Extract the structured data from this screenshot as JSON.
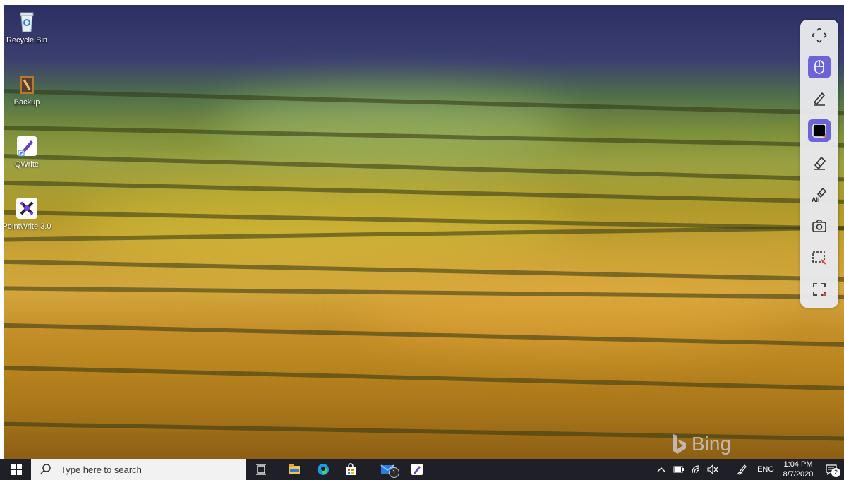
{
  "desktop_icons": [
    {
      "label": "Recycle Bin",
      "icon": "recycle-bin-icon"
    },
    {
      "label": "Backup",
      "icon": "backup-icon"
    },
    {
      "label": "QWrite",
      "icon": "qwrite-icon"
    },
    {
      "label": "PointWrite 3.0",
      "icon": "pointwrite-icon"
    }
  ],
  "toolbar": {
    "items": [
      {
        "name": "move",
        "icon": "move-arrows-icon"
      },
      {
        "name": "mouse",
        "icon": "mouse-icon",
        "active": true
      },
      {
        "name": "pen",
        "icon": "pen-icon"
      },
      {
        "name": "color",
        "icon": "color-swatch-icon"
      },
      {
        "name": "eraser",
        "icon": "eraser-icon"
      },
      {
        "name": "erase-all",
        "icon": "erase-all-icon",
        "label": "All"
      },
      {
        "name": "screenshot",
        "icon": "camera-icon"
      },
      {
        "name": "region-capture",
        "icon": "region-capture-icon"
      },
      {
        "name": "fullscreen",
        "icon": "fullscreen-icon"
      }
    ],
    "accent": "#6c63d8"
  },
  "watermark": "Bing",
  "taskbar": {
    "search_placeholder": "Type here to search",
    "mail_badge": "1",
    "language": "ENG",
    "time": "1:04 PM",
    "date": "8/7/2020",
    "notification_count": "2"
  }
}
